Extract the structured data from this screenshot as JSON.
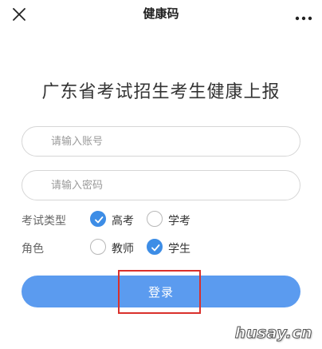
{
  "header": {
    "title": "健康码",
    "close_icon": "close-icon",
    "more_icon": "more-dots-icon"
  },
  "form": {
    "heading": "广东省考试招生考生健康上报",
    "account_placeholder": "请输入账号",
    "password_placeholder": "请输入密码",
    "exam_type": {
      "label": "考试类型",
      "options": [
        {
          "label": "高考",
          "checked": true
        },
        {
          "label": "学考",
          "checked": false
        }
      ]
    },
    "role": {
      "label": "角色",
      "options": [
        {
          "label": "教师",
          "checked": false
        },
        {
          "label": "学生",
          "checked": true
        }
      ]
    },
    "login_label": "登录"
  },
  "watermark": "husay.cn",
  "colors": {
    "accent": "#3d8de6",
    "button": "#5b9bef",
    "highlight": "#d9302c"
  }
}
